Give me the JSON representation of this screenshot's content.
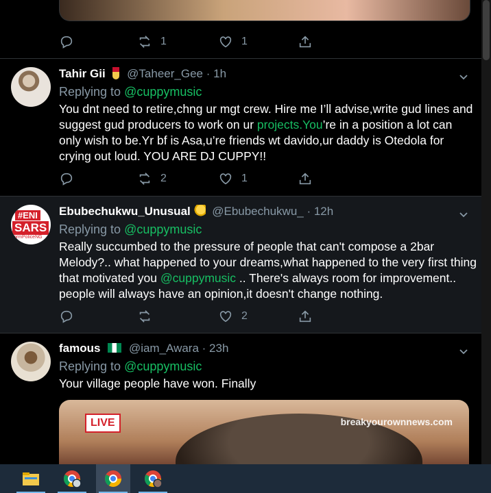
{
  "colors": {
    "background": "#000000",
    "highlight": "#15181c",
    "mention": "#17bf63",
    "muted": "#8899a6",
    "divider": "#2f3336",
    "taskbar": "#1d2b3a"
  },
  "top_actions": {
    "retweets": "1",
    "likes": "1"
  },
  "tweets": [
    {
      "name": "Tahir Gii",
      "badge_icon": "medal-icon",
      "handle": "@Taheer_Gee",
      "time": "· 1h",
      "reply_prefix": "Replying to",
      "reply_to": "@cuppymusic",
      "text_before": "You dnt need to retire,chng ur mgt crew. Hire me I’ll advise,write gud lines and suggest gud producers to work on ur ",
      "link": "projects.You",
      "text_after": "’re in a position a lot can only wish to be.Yr bf is Asa,u’re friends wt davido,ur daddy is Otedola for crying out loud. YOU ARE DJ CUPPY!!",
      "retweets": "2",
      "likes": "1"
    },
    {
      "name": "Ebubechukwu_Unusual",
      "badge_icon": "flexed-biceps-emoji",
      "handle": "@Ebubechukwu_",
      "time": "· 12h",
      "reply_prefix": "Replying to",
      "reply_to": "@cuppymusic",
      "text_before": "Really succumbed to the pressure of people that can't compose a 2bar Melody?.. what happened to your dreams,what happened to the very first thing that motivated you  ",
      "link": "@cuppymusic",
      "text_after": " .. There's always room for improvement.. people will always have an opinion,it doesn't change nothing.",
      "avatar_text_1": "#ENI",
      "avatar_text_2": "SARS",
      "avatar_text_3": "formPoliceNG",
      "retweets": "",
      "likes": "2"
    },
    {
      "name": "famous",
      "badge_icon": "nigeria-flag-icon",
      "handle": "@iam_Awara",
      "time": "· 23h",
      "reply_prefix": "Replying to",
      "reply_to": "@cuppymusic",
      "text_before": "Your village people have won. Finally",
      "media_live": "LIVE",
      "media_watermark": "breakyourownnews.com"
    }
  ],
  "taskbar": {
    "items": [
      "file-explorer-icon",
      "chrome-profile-icon",
      "chrome-icon",
      "chrome-profile-2-icon"
    ]
  }
}
